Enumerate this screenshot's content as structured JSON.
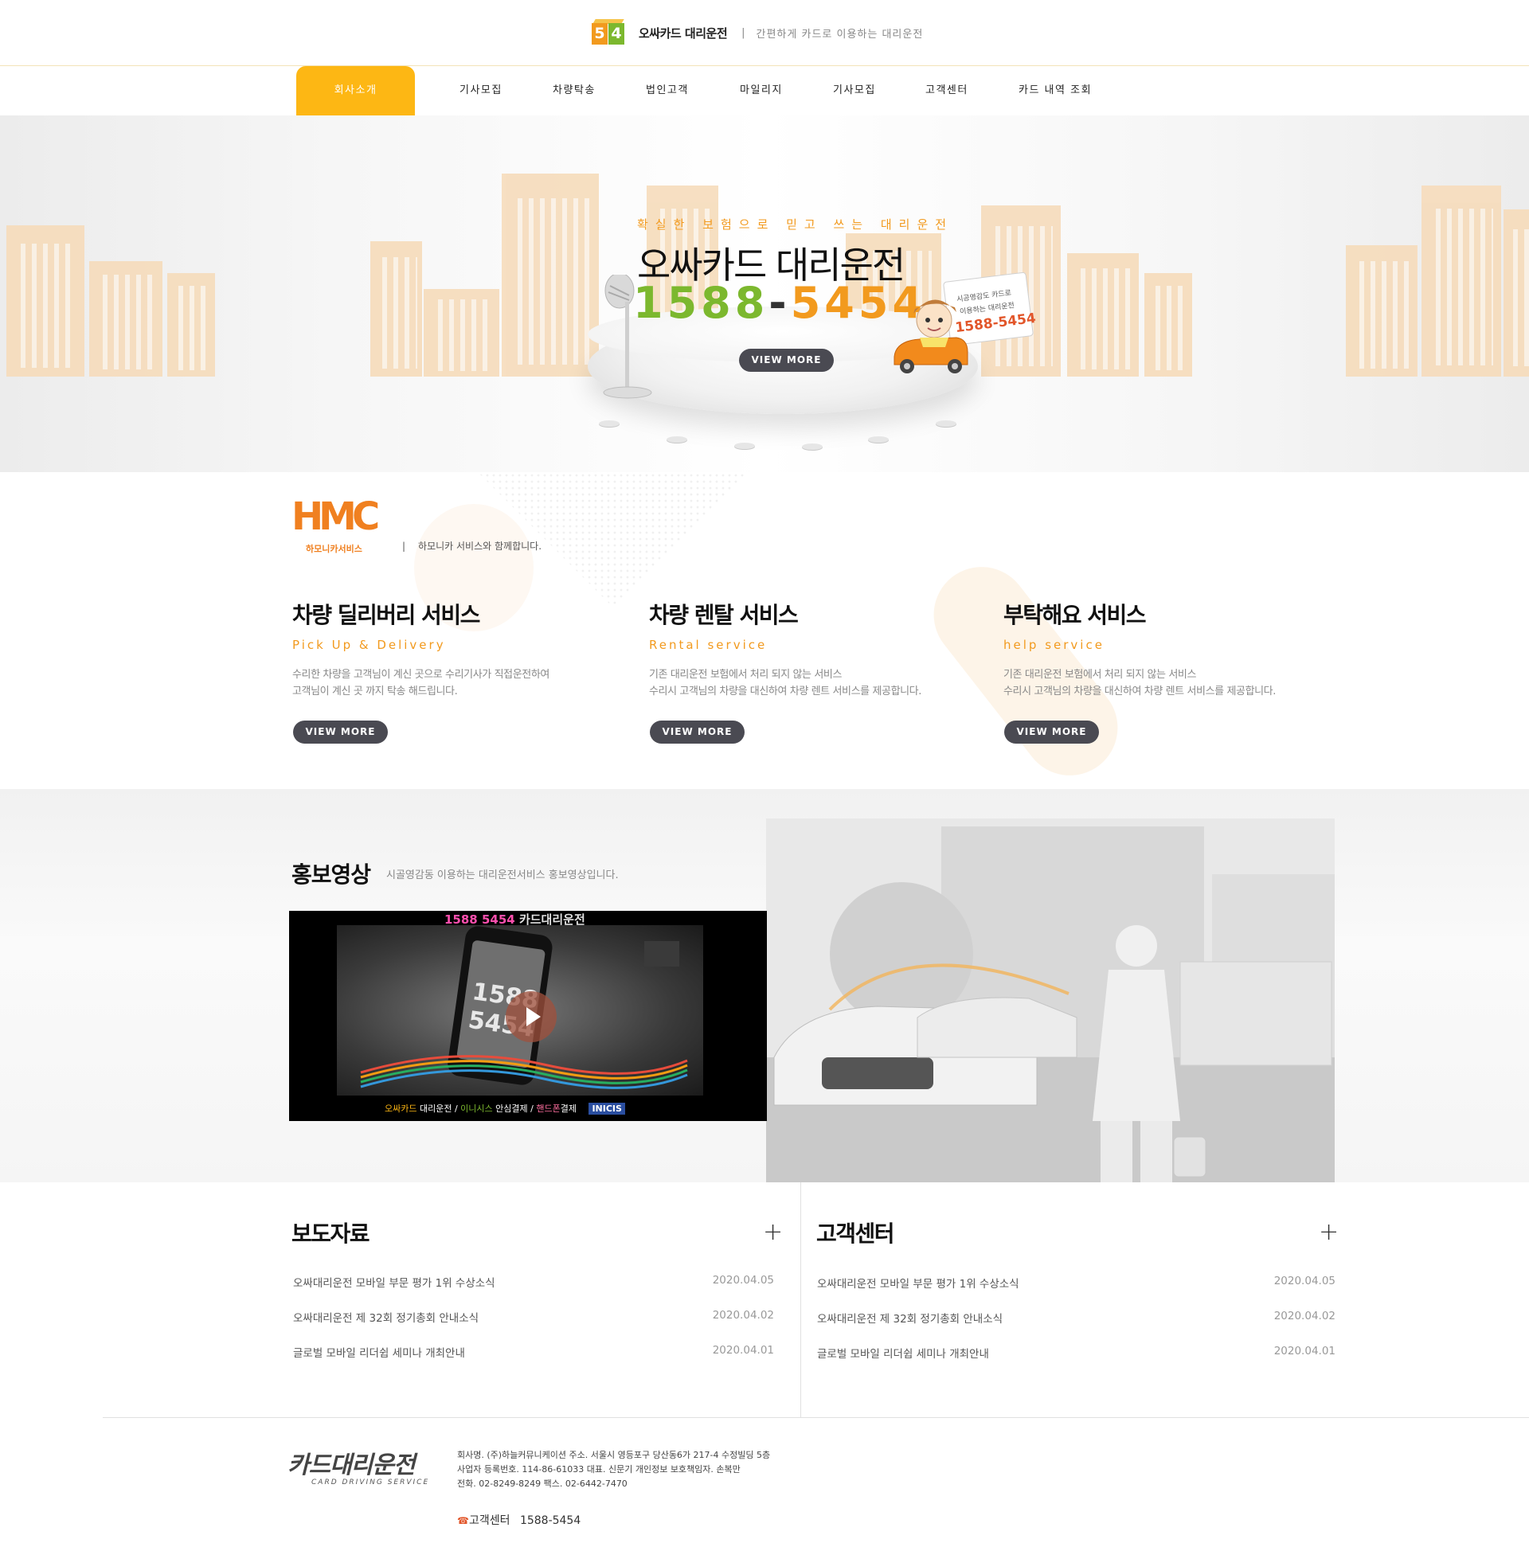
{
  "header": {
    "logo_digits": [
      "5",
      "4"
    ],
    "brand_name": "오싸카드 대리운전",
    "separator": "|",
    "tagline": "간편하게 카드로 이용하는 대리운전"
  },
  "nav": {
    "items": [
      {
        "label": "회사소개",
        "active": true
      },
      {
        "label": "기사모집"
      },
      {
        "label": "차량탁송"
      },
      {
        "label": "법인고객"
      },
      {
        "label": "마일리지"
      },
      {
        "label": "기사모집"
      },
      {
        "label": "고객센터"
      },
      {
        "label": "카드 내역 조회"
      }
    ]
  },
  "hero": {
    "kicker": "확실한 보험으로 믿고 쓰는 대리운전",
    "title": "오싸카드 대리운전",
    "phone_part1": "1588",
    "phone_dash": "-",
    "phone_part2": "5454",
    "sign_line1": "시공영감도 카드로",
    "sign_line2": "이용하는 대리운전",
    "sign_phone": "1588-5454",
    "cta_label": "VIEW MORE"
  },
  "partner": {
    "logo_text": "HMC",
    "logo_sub": "하모니카서비스",
    "separator": "|",
    "line": "하모니카 서비스와 함께합니다."
  },
  "services": [
    {
      "title": "차량 딜리버리 서비스",
      "subtitle": "Pick Up & Delivery",
      "desc1": "수리한 차량을 고객님이 계신 곳으로 수리기사가 직접운전하여",
      "desc2": "고객님이 계신 곳 까지 탁송 해드립니다.",
      "cta": "VIEW MORE"
    },
    {
      "title": "차량 렌탈 서비스",
      "subtitle": "Rental service",
      "desc1": "기존 대리운전 보험에서 처리 되지 않는 서비스",
      "desc2": "수리시 고객님의 차량을 대신하여 차량 렌트 서비스를 제공합니다.",
      "cta": "VIEW MORE"
    },
    {
      "title": "부탁해요 서비스",
      "subtitle": "help service",
      "desc1": "기존 대리운전 보험에서 처리 되지 않는 서비스",
      "desc2": "수리시 고객님의 차량을 대신하여 차량 렌트 서비스를 제공합니다.",
      "cta": "VIEW MORE"
    }
  ],
  "promo": {
    "title": "홍보영상",
    "desc": "시골영감동 이용하는 대리운전서비스 홍보영상입니다.",
    "video_top_phone": "1588 5454",
    "video_top_label": "카드대리운전",
    "video_screen_l1": "1588",
    "video_screen_l2": "5454",
    "video_bottom_a": "오싸카드",
    "video_bottom_b": "대리운전 /",
    "video_bottom_c": "이니시스",
    "video_bottom_d": "안심결제 /",
    "video_bottom_e": "핸드폰",
    "video_bottom_f": "결제",
    "video_badge": "INICIS"
  },
  "news_press": {
    "title": "보도자료",
    "more": "+",
    "rows": [
      {
        "title": "오싸대리운전 모바일 부문 평가 1위 수상소식",
        "date": "2020.04.05"
      },
      {
        "title": "오싸대리운전 제 32회 정기총회 안내소식",
        "date": "2020.04.02"
      },
      {
        "title": "글로벌 모바일 리더쉽 세미나 개최안내",
        "date": "2020.04.01"
      }
    ]
  },
  "news_cs": {
    "title": "고객센터",
    "more": "+",
    "rows": [
      {
        "title": "오싸대리운전 모바일 부문 평가 1위 수상소식",
        "date": "2020.04.05"
      },
      {
        "title": "오싸대리운전 제 32회 정기총회 안내소식",
        "date": "2020.04.02"
      },
      {
        "title": "글로벌 모바일 리더쉽 세미나 개최안내",
        "date": "2020.04.01"
      }
    ]
  },
  "footer": {
    "logo": "카드대리운전",
    "logo_sub": "CARD DRIVING SERVICE",
    "info1": "회사명. (주)하늘커뮤니케이션 주소. 서울시 영등포구 당산동6가 217-4 수정빌딩 5층",
    "info2": "사업자 등록번호. 114-86-61033 대표. 신문기 개인정보 보호책임자. 손복만",
    "info3": "전화. 02-8249-8249 팩스. 02-6442-7470",
    "cs_icon": "☎",
    "cs_label": "고객센터",
    "cs_phone": "1588-5454"
  },
  "colors": {
    "accent": "#fdb714",
    "orange": "#f29a1e",
    "green": "#7cb82e",
    "button_dark": "#4a4a52"
  }
}
